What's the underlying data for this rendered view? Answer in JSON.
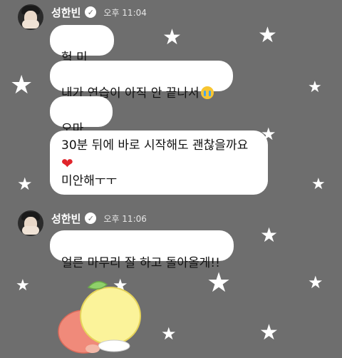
{
  "messages": [
    {
      "sender": "성한빈",
      "time": "오후 11:04",
      "lines": [
        "헉 미안..",
        "내가 연습이 아직 안 끝나서",
        "오마이..",
        "30분 뒤에 바로 시작해도 괜찮을까요",
        "미안해ㅜㅜ"
      ]
    },
    {
      "sender": "성한빈",
      "time": "오후 11:06",
      "lines": [
        "얼른 마무리 잘 하고 돌아올게!!"
      ]
    }
  ],
  "icons": {
    "verified": "verified-badge-icon",
    "crying_face": "loudly-crying-face-emoji",
    "heart": "red-heart-emoji",
    "sticker": "lemon-character-sticker"
  },
  "colors": {
    "background": "#6e6e6e",
    "bubble": "#ffffff",
    "heart": "#e0242b"
  }
}
